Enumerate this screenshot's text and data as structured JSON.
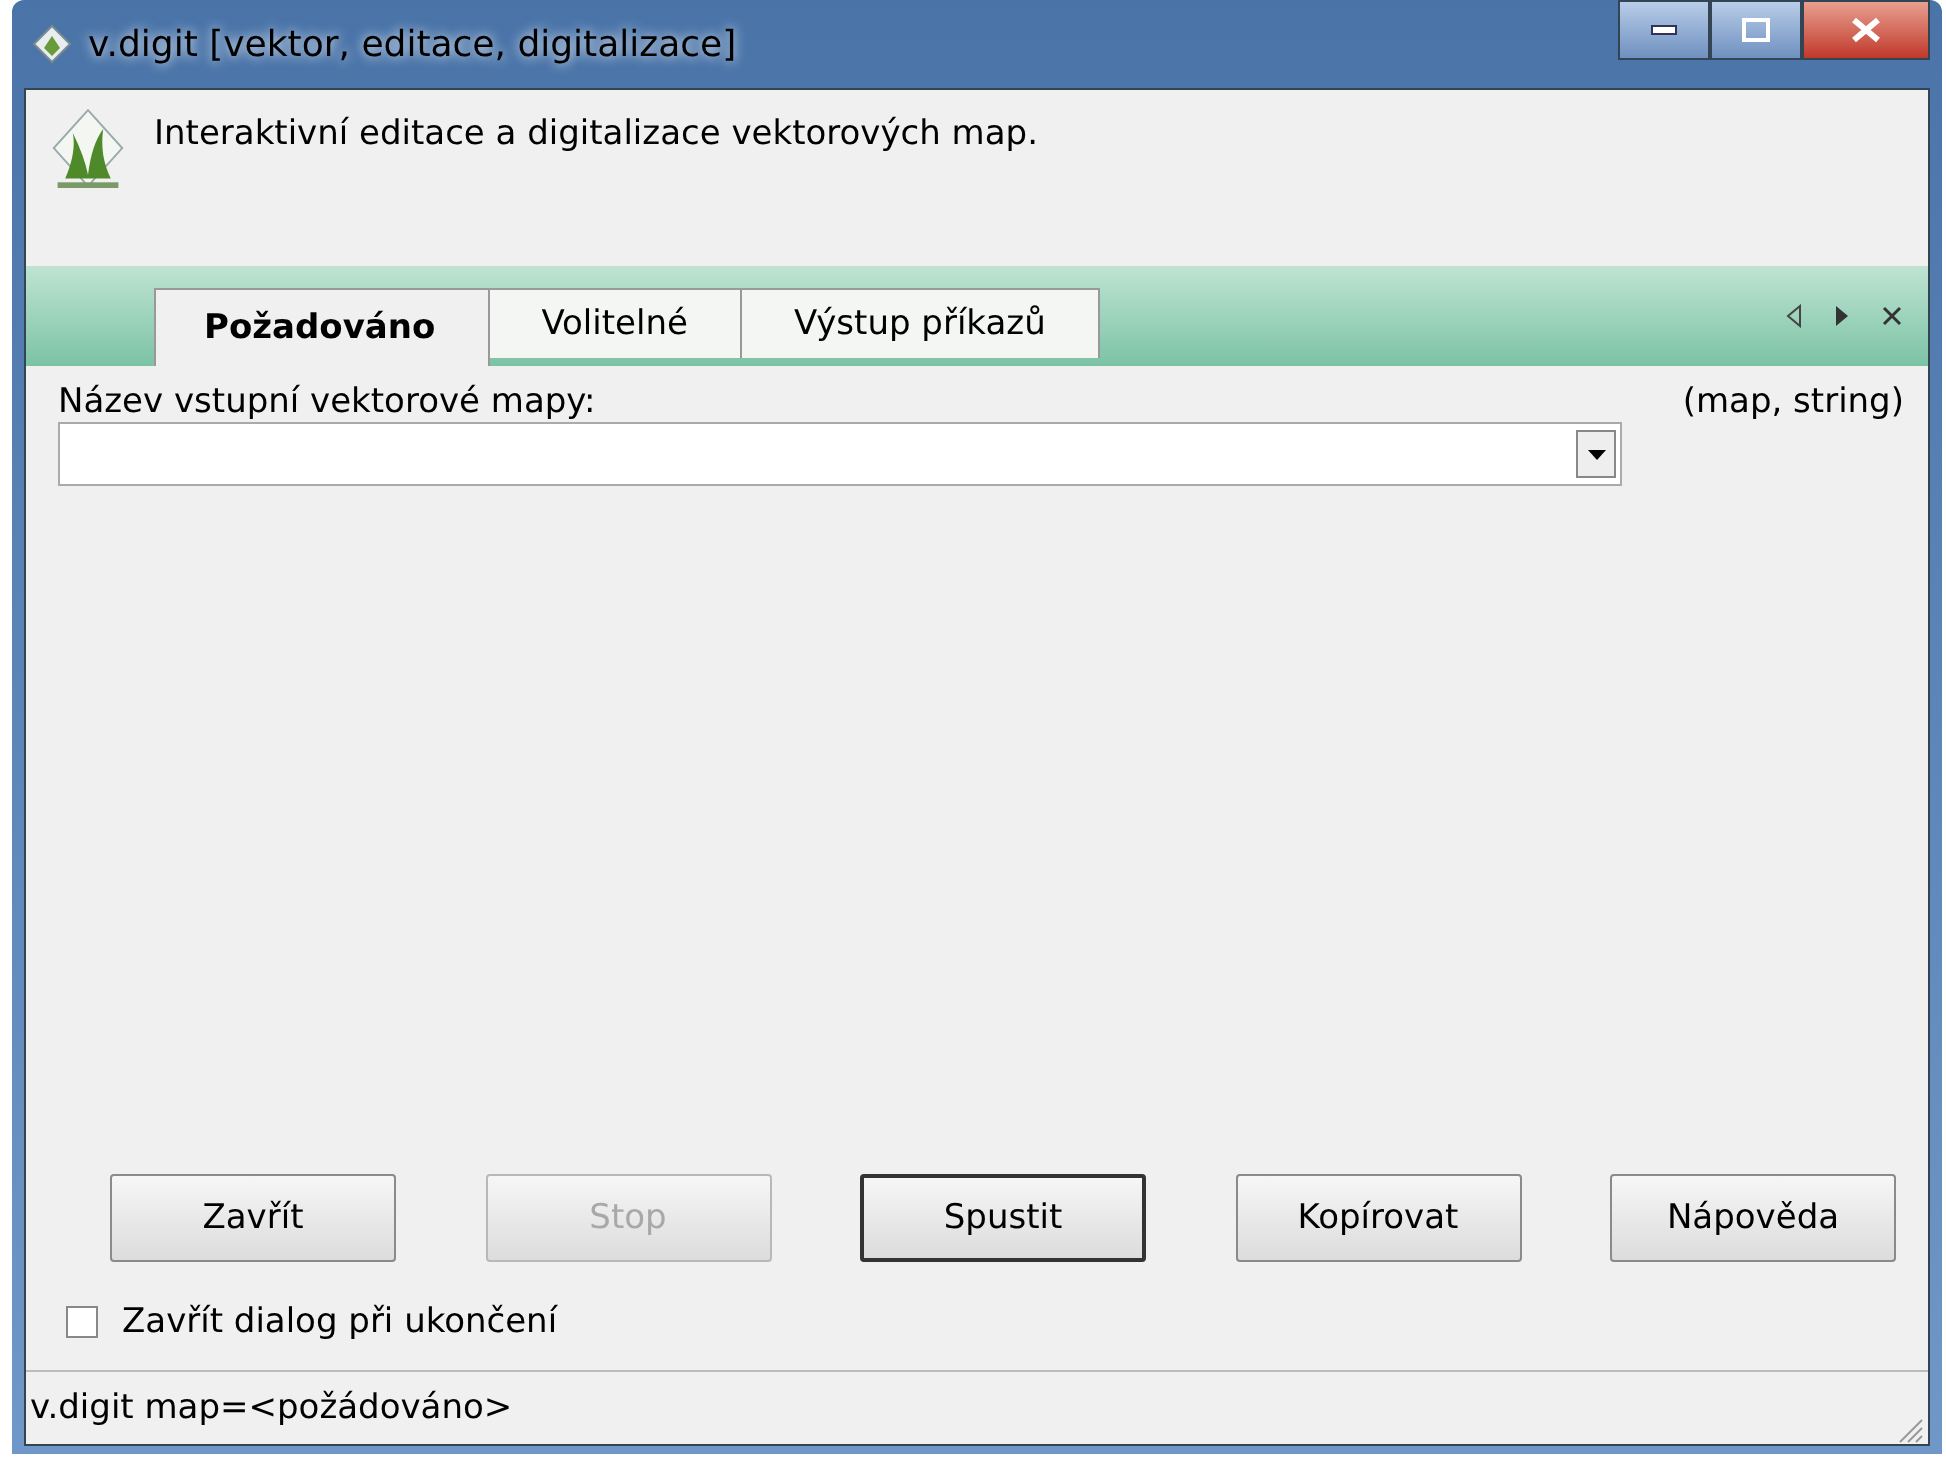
{
  "window": {
    "title": "v.digit [vektor, editace, digitalizace]"
  },
  "header": {
    "description": "Interaktivní editace a digitalizace vektorových map."
  },
  "tabs": [
    {
      "label": "Požadováno",
      "selected": true
    },
    {
      "label": "Volitelné",
      "selected": false
    },
    {
      "label": "Výstup příkazů",
      "selected": false
    }
  ],
  "field": {
    "label": "Název vstupní vektorové mapy:",
    "type_hint": "(map, string)"
  },
  "buttons": [
    {
      "label": "Zavřít",
      "disabled": false,
      "default": false
    },
    {
      "label": "Stop",
      "disabled": true,
      "default": false
    },
    {
      "label": "Spustit",
      "disabled": false,
      "default": true
    },
    {
      "label": "Kopírovat",
      "disabled": false,
      "default": false
    },
    {
      "label": "Nápověda",
      "disabled": false,
      "default": false
    }
  ],
  "close_option": {
    "label": "Zavřít dialog při ukončení",
    "checked": false
  },
  "status_bar": {
    "text": "v.digit map=<požádováno>"
  }
}
